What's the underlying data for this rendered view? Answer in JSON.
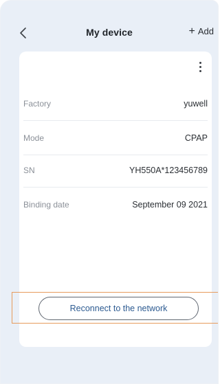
{
  "header": {
    "title": "My device",
    "add_label": "Add",
    "add_icon": "+"
  },
  "device_info": {
    "rows": [
      {
        "label": "Factory",
        "value": "yuwell"
      },
      {
        "label": "Mode",
        "value": "CPAP"
      },
      {
        "label": "SN",
        "value": "YH550A*123456789"
      },
      {
        "label": "Binding date",
        "value": "September 09 2021"
      }
    ]
  },
  "actions": {
    "reconnect_label": "Reconnect to the network"
  },
  "colors": {
    "background": "#e9eff7",
    "card": "#ffffff",
    "highlight": "#e79a5b",
    "button_text": "#2d5b91"
  }
}
